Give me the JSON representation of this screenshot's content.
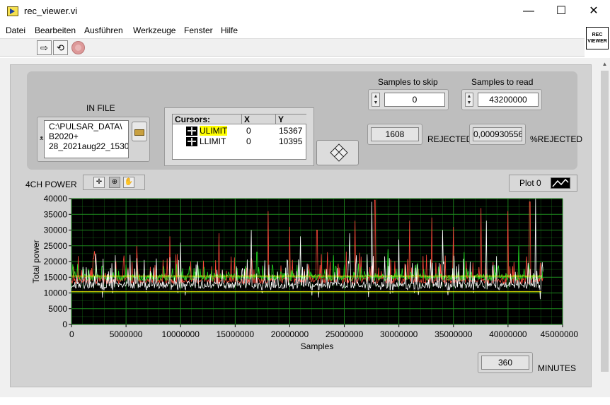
{
  "window": {
    "title": "rec_viewer.vi",
    "minimize_glyph": "—",
    "maximize_glyph": "☐",
    "close_glyph": "✕"
  },
  "menu": [
    "Datei",
    "Bearbeiten",
    "Ausführen",
    "Werkzeuge",
    "Fenster",
    "Hilfe"
  ],
  "toolbar": {
    "run_icon": "run-arrow-icon",
    "run_continuous_icon": "run-continuously-icon",
    "abort_icon": "abort-execution-icon"
  },
  "vi_icon": {
    "line1": "REC",
    "line2": "VIEWER"
  },
  "in_file": {
    "label": "IN FILE",
    "path_lines": [
      "C:\\PULSAR_DATA\\",
      "B2020+",
      "28_2021aug22_1530",
      "...."
    ]
  },
  "cursors": {
    "headers": [
      "Cursors:",
      "X",
      "Y"
    ],
    "rows": [
      {
        "name": "ULIMIT",
        "x": "0",
        "y": "15367"
      },
      {
        "name": "LLIMIT",
        "x": "0",
        "y": "10395"
      }
    ]
  },
  "samples_to_skip": {
    "label": "Samples to skip",
    "value": "0"
  },
  "samples_to_read": {
    "label": "Samples to read",
    "value": "43200000"
  },
  "rejected": {
    "value": "1608",
    "label": "REJECTED"
  },
  "pct_rejected": {
    "value": "0,000930556",
    "label": "%REJECTED"
  },
  "graph": {
    "label": "4CH POWER",
    "legend_label": "Plot 0"
  },
  "minutes": {
    "value": "360",
    "label": "MINUTES"
  },
  "chart_data": {
    "type": "line",
    "xlabel": "Samples",
    "ylabel": "Total power",
    "xlim": [
      0,
      45000000
    ],
    "ylim": [
      0,
      40000
    ],
    "xticks": [
      0,
      5000000,
      10000000,
      15000000,
      20000000,
      25000000,
      30000000,
      35000000,
      40000000,
      45000000
    ],
    "yticks": [
      0,
      5000,
      10000,
      15000,
      20000,
      25000,
      30000,
      35000,
      40000
    ],
    "grid": true,
    "background": "#000000",
    "grid_color": "#1e8a1e",
    "data_end_x": 43200000,
    "cursor_lines": [
      {
        "name": "ULIMIT",
        "y": 15367,
        "color": "#ffff00"
      },
      {
        "name": "LLIMIT",
        "y": 10395,
        "color": "#ffff00"
      }
    ],
    "series": [
      {
        "name": "Plot 0",
        "color": "#ff4a3a",
        "baseline": 14000,
        "peaks": [
          [
            2000000,
            21000
          ],
          [
            6000000,
            25000
          ],
          [
            9000000,
            28000
          ],
          [
            13500000,
            29000
          ],
          [
            18000000,
            36000
          ],
          [
            20000000,
            31000
          ],
          [
            22500000,
            30000
          ],
          [
            26000000,
            33000
          ],
          [
            27800000,
            39500
          ],
          [
            31000000,
            33000
          ],
          [
            33000000,
            34000
          ],
          [
            35000000,
            31000
          ],
          [
            37500000,
            37000
          ],
          [
            40000000,
            36000
          ],
          [
            42000000,
            39000
          ]
        ]
      },
      {
        "color": "#22dd22",
        "baseline": 15000,
        "peaks": [
          [
            5000000,
            19000
          ],
          [
            17000000,
            23000
          ],
          [
            24000000,
            22000
          ],
          [
            29000000,
            24000
          ],
          [
            36000000,
            23000
          ],
          [
            41000000,
            25000
          ]
        ]
      },
      {
        "color": "#ffffff",
        "baseline": 12500,
        "peaks": [
          [
            4000000,
            22000
          ],
          [
            10000000,
            26000
          ],
          [
            16500000,
            30000
          ],
          [
            21000000,
            28000
          ],
          [
            25500000,
            29000
          ],
          [
            27500000,
            39000
          ],
          [
            30000000,
            27000
          ],
          [
            34000000,
            30000
          ],
          [
            38000000,
            33000
          ],
          [
            42500000,
            40000
          ]
        ]
      },
      {
        "color": "#111111",
        "baseline": 10800,
        "peaks": []
      }
    ]
  }
}
